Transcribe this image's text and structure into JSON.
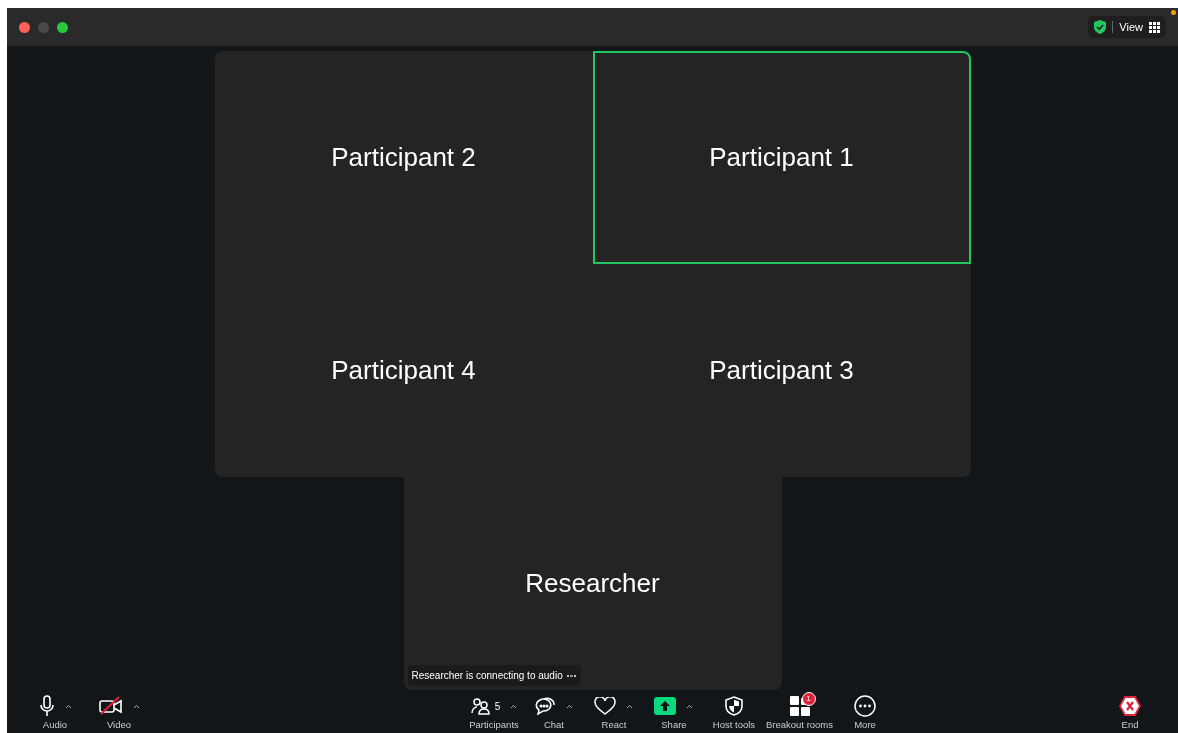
{
  "title_bar": {
    "view_label": "View"
  },
  "tiles": [
    {
      "name": "Participant 2",
      "speaking": false
    },
    {
      "name": "Participant 1",
      "speaking": true
    },
    {
      "name": "Participant 4",
      "speaking": false
    },
    {
      "name": "Participant 3",
      "speaking": false
    },
    {
      "name": "Researcher",
      "speaking": false,
      "status": "Researcher is connecting to audio"
    }
  ],
  "toolbar": {
    "left": [
      {
        "kind": "audio",
        "label": "Audio",
        "caret": true,
        "off": false
      },
      {
        "kind": "video",
        "label": "Video",
        "caret": true,
        "off": true
      }
    ],
    "center": [
      {
        "kind": "participants",
        "label": "Participants",
        "count": "5",
        "caret": true
      },
      {
        "kind": "chat",
        "label": "Chat",
        "caret": true
      },
      {
        "kind": "react",
        "label": "React",
        "caret": true
      },
      {
        "kind": "share",
        "label": "Share",
        "caret": true
      },
      {
        "kind": "host",
        "label": "Host tools",
        "caret": false
      },
      {
        "kind": "breakout",
        "label": "Breakout rooms",
        "badge": "1",
        "caret": false
      },
      {
        "kind": "more",
        "label": "More",
        "caret": false
      }
    ],
    "right": [
      {
        "kind": "end",
        "label": "End",
        "caret": false
      }
    ]
  }
}
